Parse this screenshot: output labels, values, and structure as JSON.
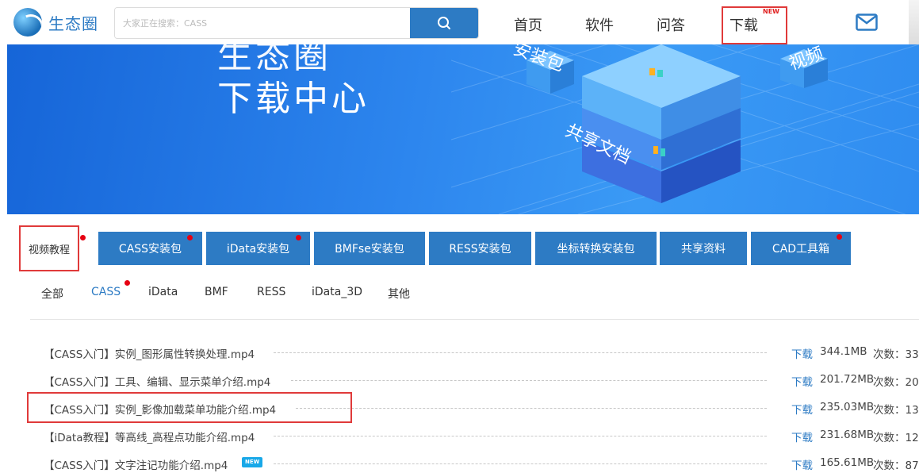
{
  "header": {
    "logo_text": "生态圈",
    "search_placeholder": "大家正在搜索：CASS",
    "nav": {
      "home": "首页",
      "software": "软件",
      "qa": "问答",
      "download": "下载",
      "download_badge": "NEW"
    }
  },
  "banner": {
    "subtitle": "生态圈",
    "title": "下载中心",
    "label_pack": "安装包",
    "label_docs": "共享文档",
    "label_video": "视频"
  },
  "tabs": [
    {
      "label": "视频教程",
      "active": true,
      "dot": true
    },
    {
      "label": "CASS安装包",
      "dot": true
    },
    {
      "label": "iData安装包",
      "dot": true
    },
    {
      "label": "BMFse安装包",
      "dot": false
    },
    {
      "label": "RESS安装包",
      "dot": false
    },
    {
      "label": "坐标转换安装包",
      "dot": false
    },
    {
      "label": "共享资料",
      "dot": false
    },
    {
      "label": "CAD工具箱",
      "dot": true
    }
  ],
  "filters": [
    {
      "label": "全部",
      "active": false
    },
    {
      "label": "CASS",
      "active": true,
      "dot": true
    },
    {
      "label": "iData",
      "active": false
    },
    {
      "label": "BMF",
      "active": false
    },
    {
      "label": "RESS",
      "active": false
    },
    {
      "label": "iData_3D",
      "active": false
    },
    {
      "label": "其他",
      "active": false
    }
  ],
  "files": [
    {
      "name": "【CASS入门】实例_图形属性转换处理.mp4",
      "action": "下载",
      "size": "344.1MB",
      "count": "次数：33"
    },
    {
      "name": "【CASS入门】工具、编辑、显示菜单介绍.mp4",
      "action": "下载",
      "size": "201.72MB",
      "count": "次数：20"
    },
    {
      "name": "【CASS入门】实例_影像加载菜单功能介绍.mp4",
      "action": "下载",
      "size": "235.03MB",
      "count": "次数：13"
    },
    {
      "name": "【iData教程】等高线_高程点功能介绍.mp4",
      "action": "下载",
      "size": "231.68MB",
      "count": "次数：12"
    },
    {
      "name": "【CASS入门】文字注记功能介绍.mp4",
      "action": "下载",
      "size": "165.61MB",
      "count": "次数：87",
      "badge": "NEW"
    }
  ],
  "colors": {
    "primary": "#2d7bc4",
    "highlight_box": "#e03a3a",
    "dot": "#e60012"
  }
}
